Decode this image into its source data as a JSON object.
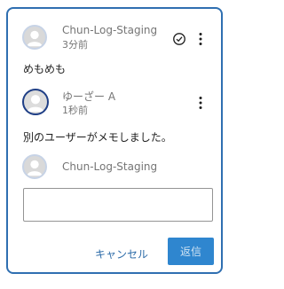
{
  "thread": {
    "comments": [
      {
        "author": "Chun-Log-Staging",
        "time": "3分前",
        "text": "めもめも",
        "resolve_icon": "check-circle-icon",
        "menu_icon": "more-vertical-icon"
      },
      {
        "author": "ゆーざー A",
        "time": "1秒前",
        "text": "別のユーザーがメモしました。",
        "menu_icon": "more-vertical-icon"
      }
    ],
    "reply": {
      "author": "Chun-Log-Staging",
      "value": "",
      "placeholder": "",
      "cancel_label": "キャンセル",
      "submit_label": "返信"
    }
  },
  "colors": {
    "border": "#2f6fb1",
    "accent": "#2f86cf",
    "link": "#2c6ba8",
    "muted_text": "#757575"
  }
}
